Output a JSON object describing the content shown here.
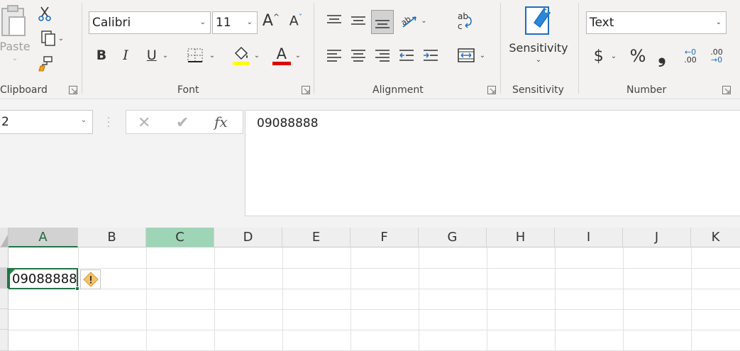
{
  "ribbon": {
    "clipboard": {
      "label": "Clipboard",
      "paste_label": "Paste"
    },
    "font": {
      "label": "Font",
      "font_name": "Calibri",
      "font_size": "11",
      "bold": "B",
      "italic": "I",
      "underline": "U",
      "font_color_letter": "A",
      "fill_color": "#ffff00",
      "font_color": "#e00000"
    },
    "alignment": {
      "label": "Alignment"
    },
    "sensitivity": {
      "label": "Sensitivity",
      "button_label": "Sensitivity"
    },
    "number": {
      "label": "Number",
      "format": "Text",
      "currency": "$",
      "percent": "%",
      "comma": "❟",
      "increase_decimal_top": "←0",
      "increase_decimal_bottom": ".00",
      "decrease_decimal_top": ".00",
      "decrease_decimal_bottom": "→0"
    }
  },
  "formula_bar": {
    "name_box": "2",
    "fx_label": "fx",
    "content": "09088888"
  },
  "sheet": {
    "columns": [
      "A",
      "B",
      "C",
      "D",
      "E",
      "F",
      "G",
      "H",
      "I",
      "J",
      "K"
    ],
    "selected_column": "A",
    "highlighted_column": "C",
    "cells": {
      "A2": "09088888"
    }
  },
  "colors": {
    "accent": "#217346",
    "highlight_column": "#9fd5b7"
  }
}
